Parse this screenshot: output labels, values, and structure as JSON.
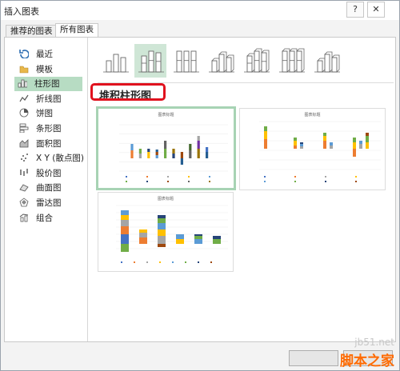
{
  "window": {
    "title": "插入图表",
    "help_label": "?",
    "close_label": "✕"
  },
  "tabs": [
    {
      "label": "推荐的图表"
    },
    {
      "label": "所有图表"
    }
  ],
  "sidebar": {
    "items": [
      {
        "label": "最近",
        "icon": "recent-icon"
      },
      {
        "label": "模板",
        "icon": "folder-icon"
      },
      {
        "label": "柱形图",
        "icon": "column-chart-icon",
        "selected": true
      },
      {
        "label": "折线图",
        "icon": "line-chart-icon"
      },
      {
        "label": "饼图",
        "icon": "pie-chart-icon"
      },
      {
        "label": "条形图",
        "icon": "bar-chart-icon"
      },
      {
        "label": "面积图",
        "icon": "area-chart-icon"
      },
      {
        "label": "X Y (散点图)",
        "icon": "scatter-chart-icon"
      },
      {
        "label": "股价图",
        "icon": "stock-chart-icon"
      },
      {
        "label": "曲面图",
        "icon": "surface-chart-icon"
      },
      {
        "label": "雷达图",
        "icon": "radar-chart-icon"
      },
      {
        "label": "组合",
        "icon": "combo-chart-icon"
      }
    ]
  },
  "subtypes": [
    {
      "name": "clustered-column",
      "selected": false
    },
    {
      "name": "stacked-column",
      "selected": true
    },
    {
      "name": "100-stacked-column",
      "selected": false
    },
    {
      "name": "3d-clustered-column",
      "selected": false
    },
    {
      "name": "3d-stacked-column",
      "selected": false
    },
    {
      "name": "3d-100-stacked-column",
      "selected": false
    },
    {
      "name": "3d-column",
      "selected": false
    }
  ],
  "selected_subtype_label": "堆积柱形图",
  "previews": [
    {
      "title": "图表标题",
      "selected": true
    },
    {
      "title": "图表标题",
      "selected": false
    },
    {
      "title": "图表标题",
      "selected": false
    }
  ],
  "colors": {
    "accent_green": "#a7d3b4",
    "highlight_red": "#e0121e",
    "series": [
      "#4472c4",
      "#ed7d31",
      "#a5a5a5",
      "#ffc000",
      "#5b9bd5",
      "#70ad47",
      "#264478",
      "#9e480e",
      "#636363",
      "#997300",
      "#255e91",
      "#43682b",
      "#7030a0"
    ]
  },
  "watermark": {
    "site": "jb51.net",
    "brand": "脚本之家"
  }
}
